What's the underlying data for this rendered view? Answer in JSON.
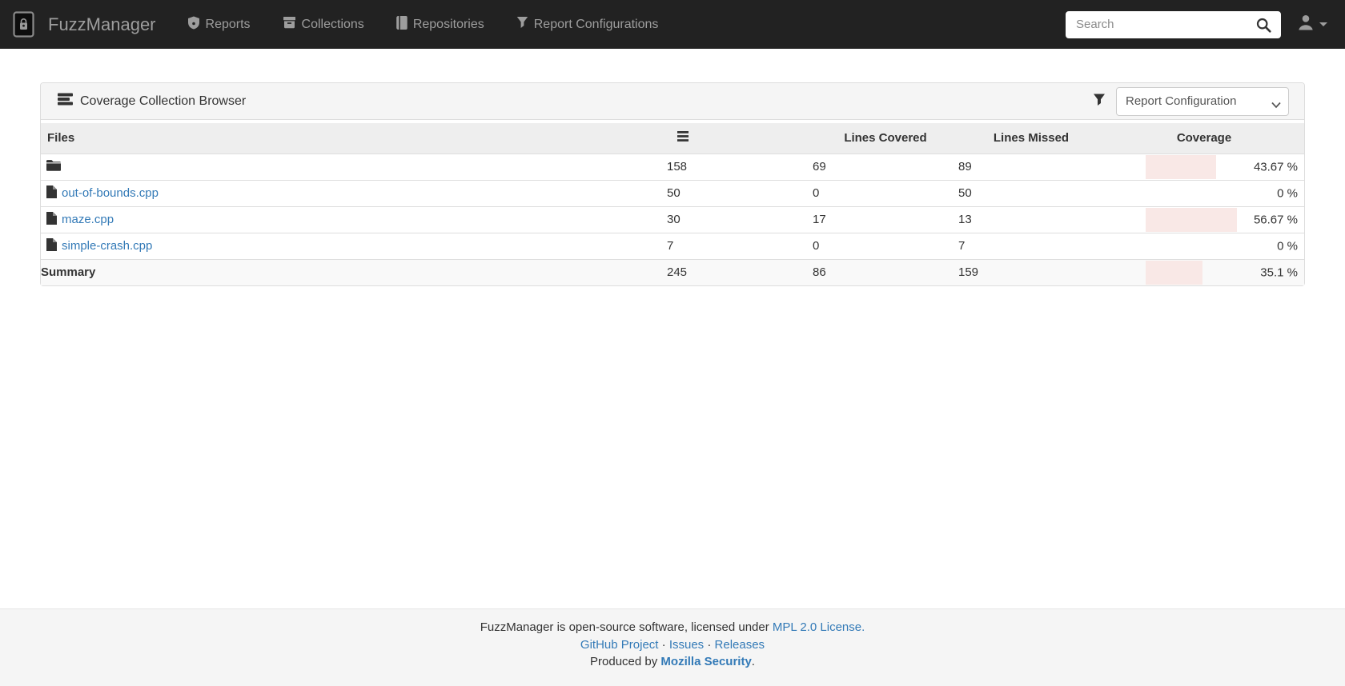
{
  "navbar": {
    "brand": "FuzzManager",
    "items": [
      {
        "id": "reports",
        "label": "Reports"
      },
      {
        "id": "collections",
        "label": "Collections"
      },
      {
        "id": "repositories",
        "label": "Repositories"
      },
      {
        "id": "report-configurations",
        "label": "Report Configurations"
      }
    ],
    "search": {
      "placeholder": "Search"
    }
  },
  "panel": {
    "title": "Coverage Collection Browser",
    "report_configuration_select": "Report Configuration"
  },
  "table": {
    "headers": {
      "files": "Files",
      "lines_covered": "Lines Covered",
      "lines_missed": "Lines Missed",
      "coverage": "Coverage"
    },
    "rows": [
      {
        "file": "",
        "icon": "folder-icon",
        "lines_total": "158",
        "lines_covered": "69",
        "lines_missed": "89",
        "coverage_pct": 43.67,
        "coverage_label": "43.67 %"
      },
      {
        "file": "out-of-bounds.cpp",
        "icon": "file-icon",
        "lines_total": "50",
        "lines_covered": "0",
        "lines_missed": "50",
        "coverage_pct": 0,
        "coverage_label": "0 %"
      },
      {
        "file": "maze.cpp",
        "icon": "file-icon",
        "lines_total": "30",
        "lines_covered": "17",
        "lines_missed": "13",
        "coverage_pct": 56.67,
        "coverage_label": "56.67 %"
      },
      {
        "file": "simple-crash.cpp",
        "icon": "file-icon",
        "lines_total": "7",
        "lines_covered": "0",
        "lines_missed": "7",
        "coverage_pct": 0,
        "coverage_label": "0 %"
      }
    ],
    "summary": {
      "label": "Summary",
      "lines_total": "245",
      "lines_covered": "86",
      "lines_missed": "159",
      "coverage_pct": 35.1,
      "coverage_label": "35.1 %"
    }
  },
  "footer": {
    "license_text": "FuzzManager is open-source software, licensed under",
    "license_link": "MPL 2.0 License.",
    "links": [
      "GitHub Project",
      "Issues",
      "Releases"
    ],
    "separator": "·",
    "produced_text": "Produced by",
    "produced_link": "Mozilla Security",
    "produced_suffix": "."
  },
  "colors": {
    "navbar_bg": "#222222",
    "navbar_text": "#9d9d9d",
    "link": "#337ab7",
    "coverage_fill": "#f9e8e6",
    "panel_border": "#dddddd"
  }
}
